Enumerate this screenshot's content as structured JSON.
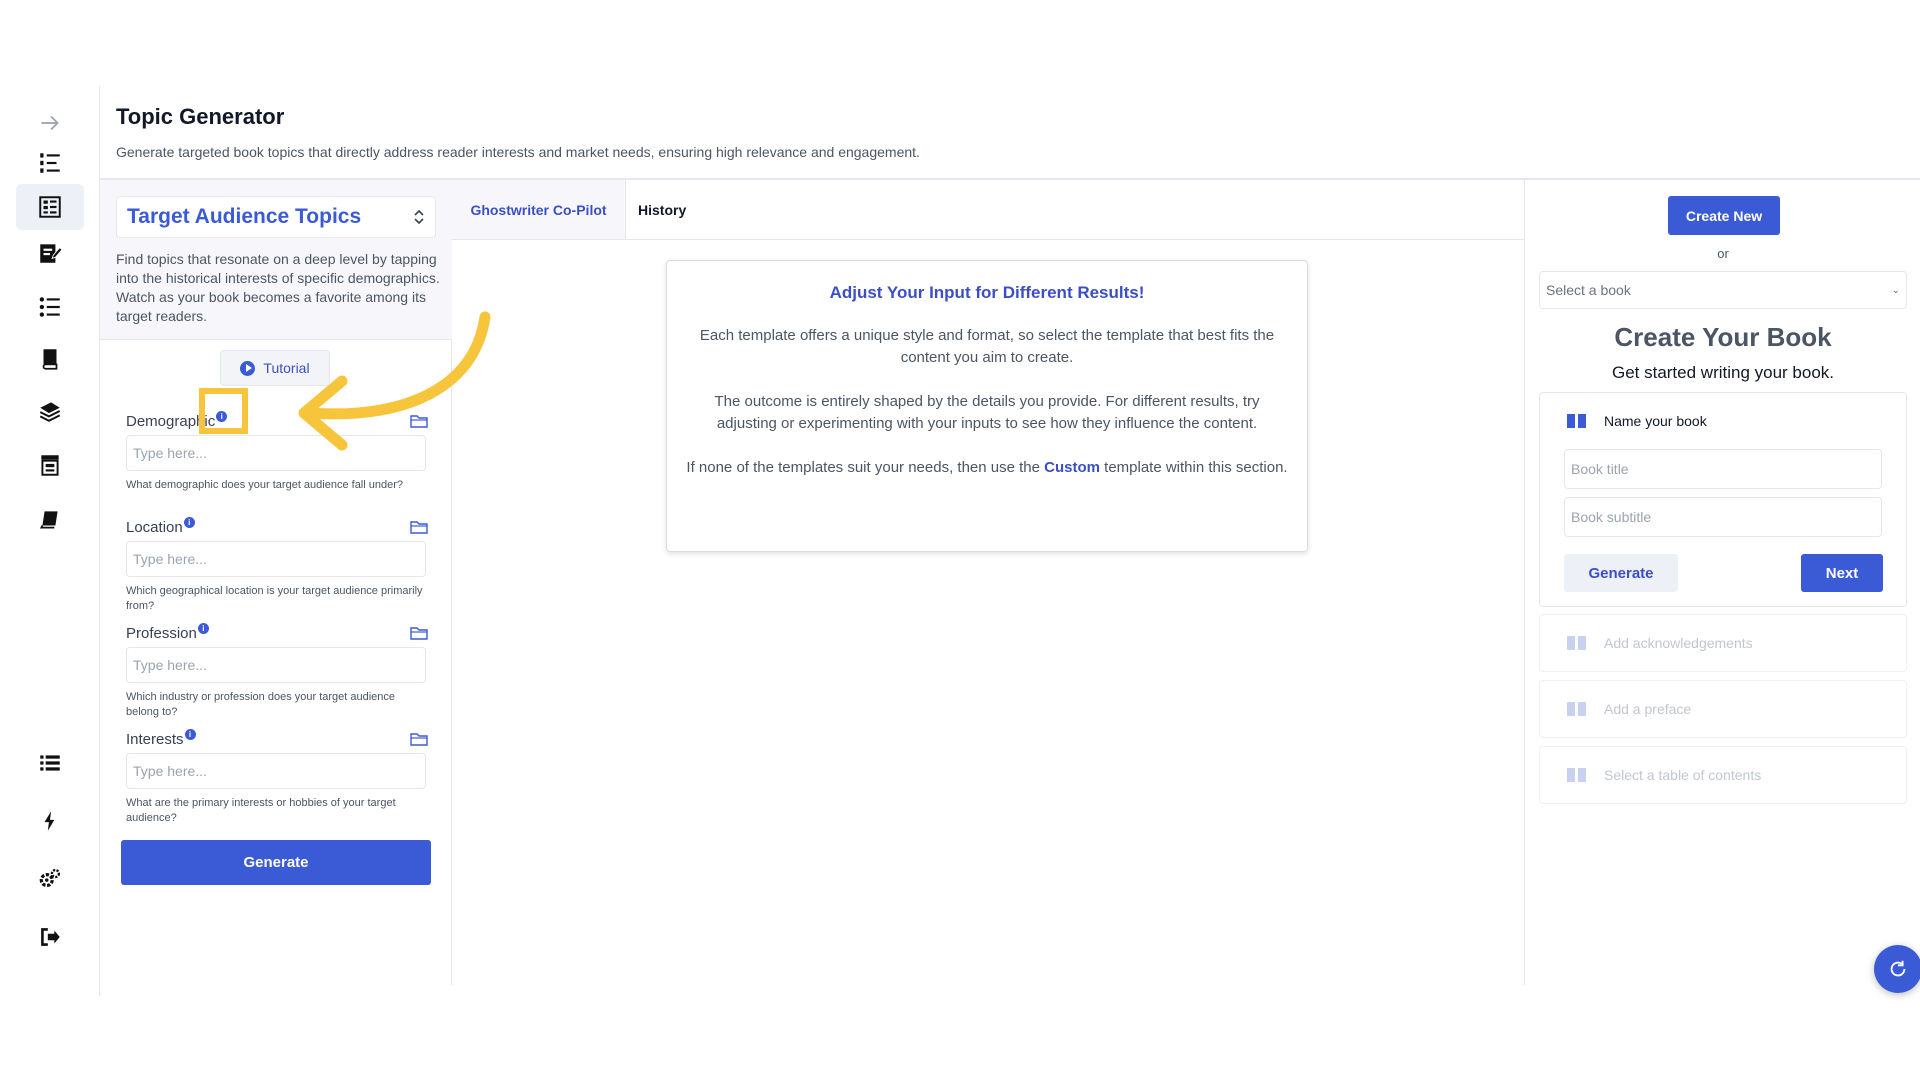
{
  "header": {
    "title": "Topic Generator",
    "description": "Generate targeted book topics that directly address reader interests and market needs, ensuring high relevance and engagement."
  },
  "sidebar": {
    "items": [
      {
        "icon": "arrow-right-icon"
      },
      {
        "icon": "numbered-list-icon"
      },
      {
        "icon": "topic-generator-icon",
        "active": true
      },
      {
        "icon": "edit-document-icon"
      },
      {
        "icon": "bullet-list-icon"
      },
      {
        "icon": "book-stack-icon"
      },
      {
        "icon": "books-icon"
      },
      {
        "icon": "storefront-icon"
      },
      {
        "icon": "book-icon"
      },
      {
        "icon": "list-icon"
      },
      {
        "icon": "lightning-icon"
      },
      {
        "icon": "settings-gears-icon"
      },
      {
        "icon": "logout-icon"
      }
    ]
  },
  "left_panel": {
    "template_label": "Target Audience Topics",
    "description": "Find topics that resonate on a deep level by tapping into the historical interests of specific demographics. Watch as your book becomes a favorite among its target readers.",
    "tutorial_label": "Tutorial",
    "fields": [
      {
        "label": "Demographic",
        "placeholder": "Type here...",
        "help": "What demographic does your target audience fall under?"
      },
      {
        "label": "Location",
        "placeholder": "Type here...",
        "help": "Which geographical location is your target audience primarily from?"
      },
      {
        "label": "Profession",
        "placeholder": "Type here...",
        "help": "Which industry or profession does your target audience belong to?"
      },
      {
        "label": "Interests",
        "placeholder": "Type here...",
        "help": "What are the primary interests or hobbies of your target audience?"
      }
    ],
    "generate_label": "Generate"
  },
  "center": {
    "tabs": [
      "Ghostwriter Co-Pilot",
      "History"
    ],
    "card": {
      "title": "Adjust Your Input for Different Results!",
      "p1": "Each template offers a unique style and format, so select the template that best fits the content you aim to create.",
      "p2": "The outcome is entirely shaped by the details you provide. For different results, try adjusting or experimenting with your inputs to see how they influence the content.",
      "p3_before": "If none of the templates suit your needs, then use the ",
      "p3_link": "Custom",
      "p3_after": " template within this section."
    }
  },
  "right_panel": {
    "create_new_label": "Create New",
    "or_label": "or",
    "select_book_placeholder": "Select a book",
    "title": "Create Your Book",
    "subtitle": "Get started writing your book.",
    "step_name": "Name your book",
    "book_title_placeholder": "Book title",
    "book_subtitle_placeholder": "Book subtitle",
    "generate_label": "Generate",
    "next_label": "Next",
    "disabled_steps": [
      "Add acknowledgements",
      "Add a preface",
      "Select a table of contents"
    ]
  },
  "colors": {
    "accent": "#3b5bd6",
    "highlight": "#f7c53c"
  }
}
